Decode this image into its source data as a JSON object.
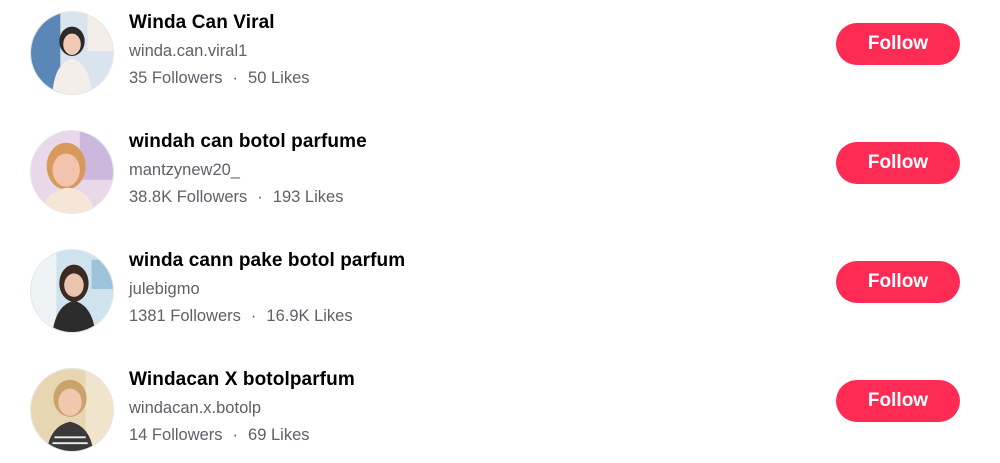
{
  "users": [
    {
      "name": "Winda Can Viral",
      "handle": "winda.can.viral1",
      "followers": "35 Followers",
      "likes": "50 Likes",
      "follow_label": "Follow",
      "avatar_colors": [
        "#d9e4ee",
        "#f3eee9",
        "#2a2a2a",
        "#f0c9b4"
      ]
    },
    {
      "name": "windah can botol parfume",
      "handle": "mantzynew20_",
      "followers": "38.8K Followers",
      "likes": "193 Likes",
      "follow_label": "Follow",
      "avatar_colors": [
        "#e9d7ea",
        "#f5e6d8",
        "#d89a5a",
        "#f2c4b0"
      ]
    },
    {
      "name": "winda cann pake botol parfum",
      "handle": "julebigmo",
      "followers": "1381 Followers",
      "likes": "16.9K Likes",
      "follow_label": "Follow",
      "avatar_colors": [
        "#cfe3ef",
        "#eef3f6",
        "#3b2a22",
        "#e9c3ae"
      ]
    },
    {
      "name": "Windacan X botolparfum",
      "handle": "windacan.x.botolp",
      "followers": "14 Followers",
      "likes": "69 Likes",
      "follow_label": "Follow",
      "avatar_colors": [
        "#e8d6b2",
        "#f1e4cc",
        "#c9a36a",
        "#f0c8ae"
      ]
    }
  ],
  "separator": "·",
  "accent_color": "#fe2c55"
}
